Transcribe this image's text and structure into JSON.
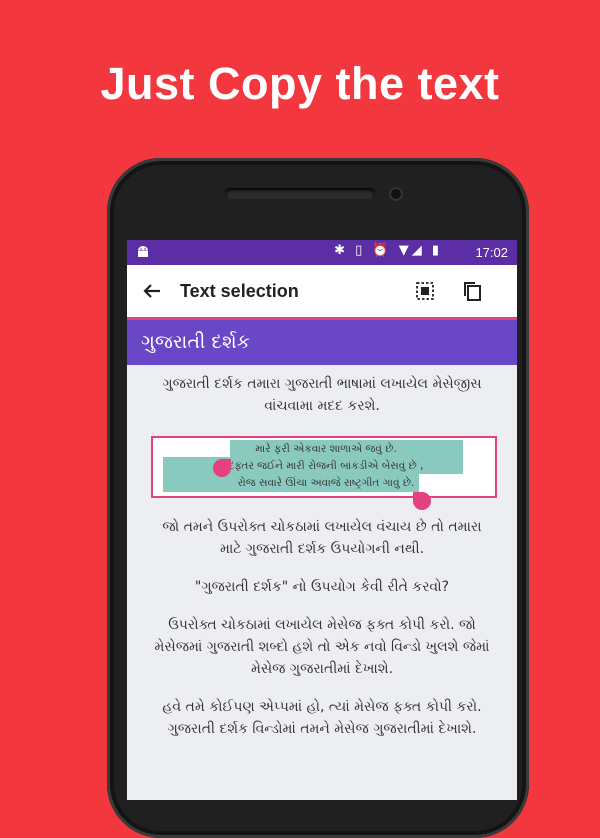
{
  "headline": "Just Copy the text",
  "status_bar": {
    "icons": "✱ ▯ ⏰ ▼◢ ▮",
    "time": "17:02"
  },
  "toolbar": {
    "title": "Text selection",
    "actions": [
      "select-all-icon",
      "copy-icon"
    ]
  },
  "app": {
    "title": "ગુજરાતી દર્શક"
  },
  "content": {
    "intro": "ગુજરાતી દર્શક તમારા ગુજરાતી ભાષામાં લખાયેલ મેસેજીસ વાંચવામા મદદ કરશે.",
    "sample_lines": [
      "મારે ફરી એકવાર શાળાએ જવું છે.",
      "દફ્તર જઈને મારી રોજની બાંકડીએ બેસવું છે ,",
      "રોજ સવારે ઊંચા અવાજે રાષ્ટ્રગીત ગાવું છે."
    ],
    "para2": "જો તમને ઉપરોક્ત ચોકઠામાં લખાયેલ વંચાય છે તો તમારા માટે ગુજરાતી દર્શક ઉપયોગની નથી.",
    "para3": "\"ગુજરાતી દર્શક\" નો ઉપયોગ કેવી રીતે કરવો?",
    "para4": "ઉપરોક્ત ચોકઠામાં લખાયેલ મેસેજ ફક્ત કોપી કરો. જો મેસેજમાં ગુજરાતી શબ્દો હશે તો એક નવો વિન્ડો ખુલશે જેમાં મેસેજ ગુજરાતીમાં દેખાશે.",
    "para5": "હવે તમે કોઈપણ એપ્પમાં હો, ત્યાં મેસેજ ફક્ત કોપી કરો. ગુજરાતી દર્શક વિન્ડોમાં તમને મેસેજ ગુજરાતીમાં દેખાશે."
  },
  "colors": {
    "background": "#f2373e",
    "status_bar": "#5c2ea6",
    "app_bar": "#6947c7",
    "accent": "#e5407f",
    "selection": "#8ac9bd"
  }
}
